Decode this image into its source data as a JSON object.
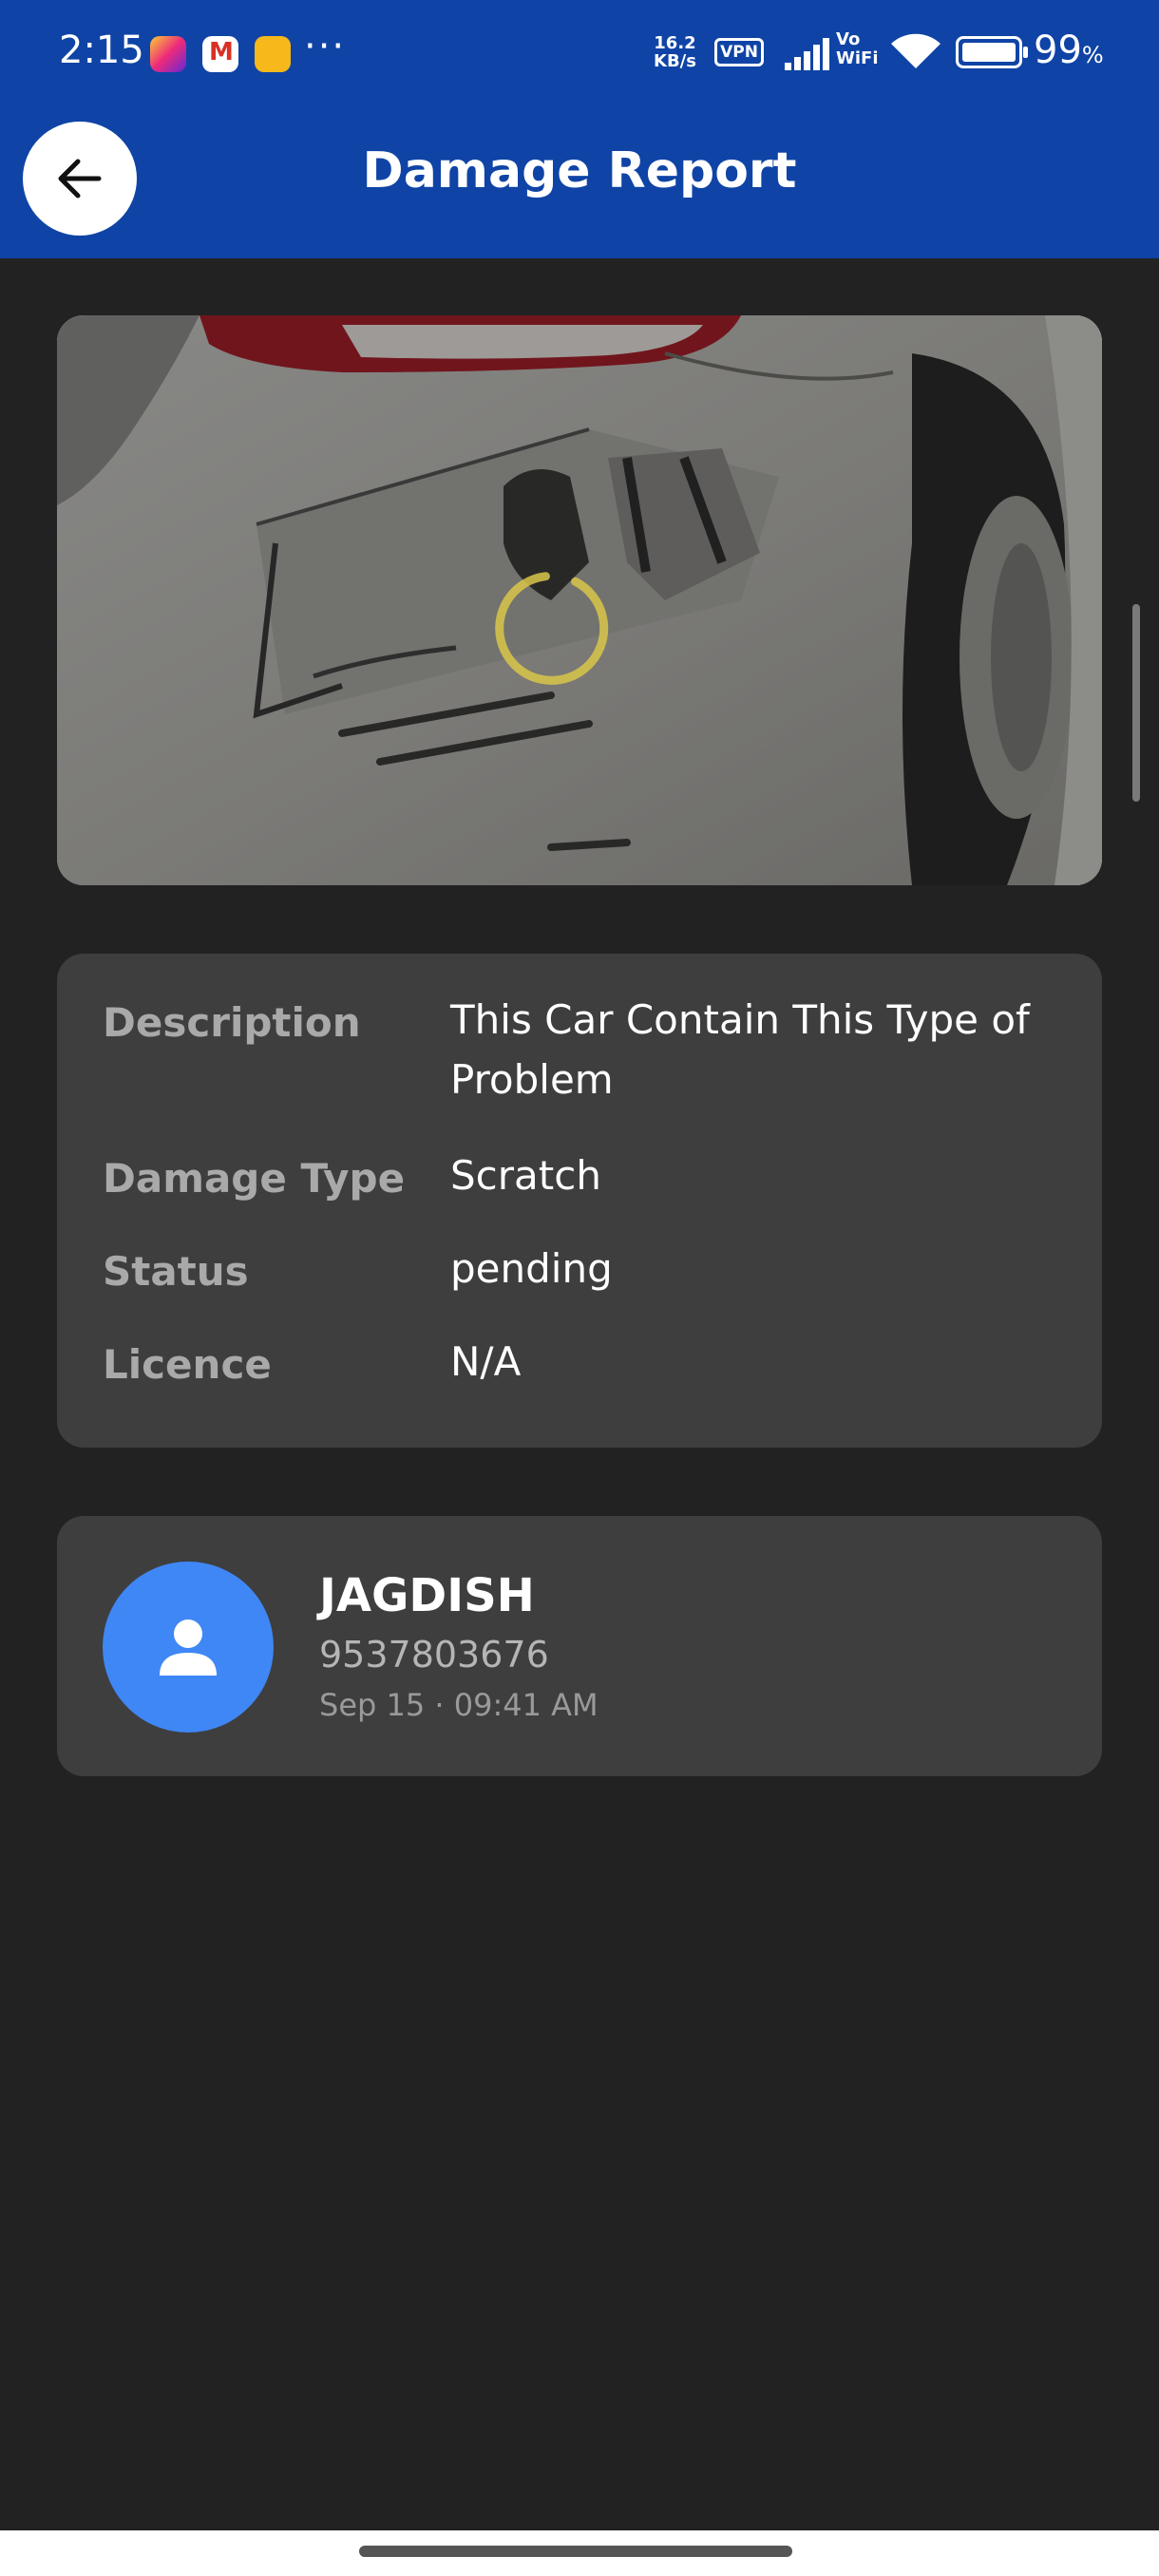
{
  "status_bar": {
    "time": "2:15",
    "more": "···",
    "net_speed_value": "16.2",
    "net_speed_unit": "KB/s",
    "vpn": "VPN",
    "vowifi_line1": "Vo",
    "vowifi_line2": "WiFi",
    "battery": "99",
    "battery_unit": "%"
  },
  "header": {
    "title": "Damage Report"
  },
  "details": {
    "description_label": "Description",
    "description_value": "This Car Contain This Type of Problem",
    "damage_type_label": "Damage Type",
    "damage_type_value": "Scratch",
    "status_label": "Status",
    "status_value": "pending",
    "licence_label": "Licence",
    "licence_value": "N/A"
  },
  "reporter": {
    "name": "JAGDISH",
    "phone": "9537803676",
    "datetime": "Sep 15 · 09:41 AM"
  },
  "colors": {
    "app_bar": "#0f44a6",
    "background": "#222223",
    "card": "#3e3e3f",
    "avatar": "#3f87f5",
    "spinner": "#d8c64a"
  }
}
